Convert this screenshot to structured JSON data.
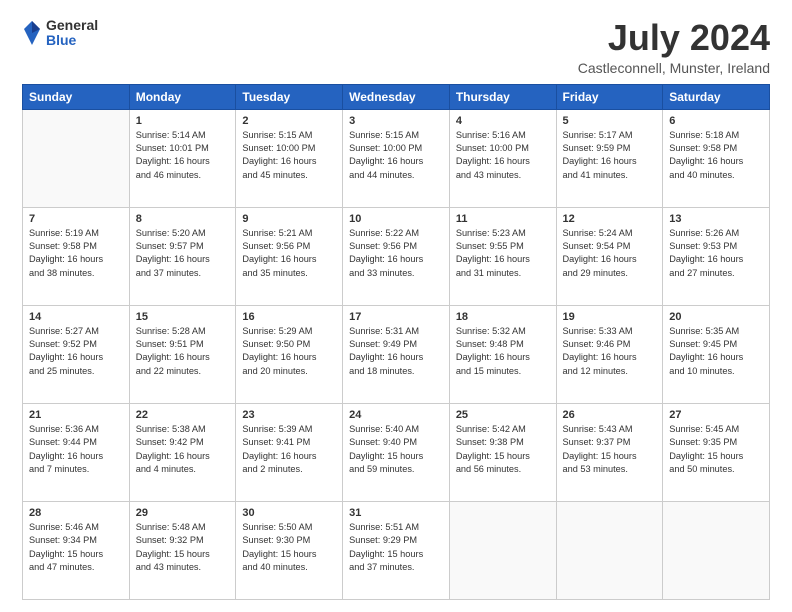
{
  "logo": {
    "general": "General",
    "blue": "Blue"
  },
  "title": "July 2024",
  "location": "Castleconnell, Munster, Ireland",
  "headers": [
    "Sunday",
    "Monday",
    "Tuesday",
    "Wednesday",
    "Thursday",
    "Friday",
    "Saturday"
  ],
  "weeks": [
    [
      {
        "day": "",
        "info": ""
      },
      {
        "day": "1",
        "info": "Sunrise: 5:14 AM\nSunset: 10:01 PM\nDaylight: 16 hours\nand 46 minutes."
      },
      {
        "day": "2",
        "info": "Sunrise: 5:15 AM\nSunset: 10:00 PM\nDaylight: 16 hours\nand 45 minutes."
      },
      {
        "day": "3",
        "info": "Sunrise: 5:15 AM\nSunset: 10:00 PM\nDaylight: 16 hours\nand 44 minutes."
      },
      {
        "day": "4",
        "info": "Sunrise: 5:16 AM\nSunset: 10:00 PM\nDaylight: 16 hours\nand 43 minutes."
      },
      {
        "day": "5",
        "info": "Sunrise: 5:17 AM\nSunset: 9:59 PM\nDaylight: 16 hours\nand 41 minutes."
      },
      {
        "day": "6",
        "info": "Sunrise: 5:18 AM\nSunset: 9:58 PM\nDaylight: 16 hours\nand 40 minutes."
      }
    ],
    [
      {
        "day": "7",
        "info": "Sunrise: 5:19 AM\nSunset: 9:58 PM\nDaylight: 16 hours\nand 38 minutes."
      },
      {
        "day": "8",
        "info": "Sunrise: 5:20 AM\nSunset: 9:57 PM\nDaylight: 16 hours\nand 37 minutes."
      },
      {
        "day": "9",
        "info": "Sunrise: 5:21 AM\nSunset: 9:56 PM\nDaylight: 16 hours\nand 35 minutes."
      },
      {
        "day": "10",
        "info": "Sunrise: 5:22 AM\nSunset: 9:56 PM\nDaylight: 16 hours\nand 33 minutes."
      },
      {
        "day": "11",
        "info": "Sunrise: 5:23 AM\nSunset: 9:55 PM\nDaylight: 16 hours\nand 31 minutes."
      },
      {
        "day": "12",
        "info": "Sunrise: 5:24 AM\nSunset: 9:54 PM\nDaylight: 16 hours\nand 29 minutes."
      },
      {
        "day": "13",
        "info": "Sunrise: 5:26 AM\nSunset: 9:53 PM\nDaylight: 16 hours\nand 27 minutes."
      }
    ],
    [
      {
        "day": "14",
        "info": "Sunrise: 5:27 AM\nSunset: 9:52 PM\nDaylight: 16 hours\nand 25 minutes."
      },
      {
        "day": "15",
        "info": "Sunrise: 5:28 AM\nSunset: 9:51 PM\nDaylight: 16 hours\nand 22 minutes."
      },
      {
        "day": "16",
        "info": "Sunrise: 5:29 AM\nSunset: 9:50 PM\nDaylight: 16 hours\nand 20 minutes."
      },
      {
        "day": "17",
        "info": "Sunrise: 5:31 AM\nSunset: 9:49 PM\nDaylight: 16 hours\nand 18 minutes."
      },
      {
        "day": "18",
        "info": "Sunrise: 5:32 AM\nSunset: 9:48 PM\nDaylight: 16 hours\nand 15 minutes."
      },
      {
        "day": "19",
        "info": "Sunrise: 5:33 AM\nSunset: 9:46 PM\nDaylight: 16 hours\nand 12 minutes."
      },
      {
        "day": "20",
        "info": "Sunrise: 5:35 AM\nSunset: 9:45 PM\nDaylight: 16 hours\nand 10 minutes."
      }
    ],
    [
      {
        "day": "21",
        "info": "Sunrise: 5:36 AM\nSunset: 9:44 PM\nDaylight: 16 hours\nand 7 minutes."
      },
      {
        "day": "22",
        "info": "Sunrise: 5:38 AM\nSunset: 9:42 PM\nDaylight: 16 hours\nand 4 minutes."
      },
      {
        "day": "23",
        "info": "Sunrise: 5:39 AM\nSunset: 9:41 PM\nDaylight: 16 hours\nand 2 minutes."
      },
      {
        "day": "24",
        "info": "Sunrise: 5:40 AM\nSunset: 9:40 PM\nDaylight: 15 hours\nand 59 minutes."
      },
      {
        "day": "25",
        "info": "Sunrise: 5:42 AM\nSunset: 9:38 PM\nDaylight: 15 hours\nand 56 minutes."
      },
      {
        "day": "26",
        "info": "Sunrise: 5:43 AM\nSunset: 9:37 PM\nDaylight: 15 hours\nand 53 minutes."
      },
      {
        "day": "27",
        "info": "Sunrise: 5:45 AM\nSunset: 9:35 PM\nDaylight: 15 hours\nand 50 minutes."
      }
    ],
    [
      {
        "day": "28",
        "info": "Sunrise: 5:46 AM\nSunset: 9:34 PM\nDaylight: 15 hours\nand 47 minutes."
      },
      {
        "day": "29",
        "info": "Sunrise: 5:48 AM\nSunset: 9:32 PM\nDaylight: 15 hours\nand 43 minutes."
      },
      {
        "day": "30",
        "info": "Sunrise: 5:50 AM\nSunset: 9:30 PM\nDaylight: 15 hours\nand 40 minutes."
      },
      {
        "day": "31",
        "info": "Sunrise: 5:51 AM\nSunset: 9:29 PM\nDaylight: 15 hours\nand 37 minutes."
      },
      {
        "day": "",
        "info": ""
      },
      {
        "day": "",
        "info": ""
      },
      {
        "day": "",
        "info": ""
      }
    ]
  ]
}
